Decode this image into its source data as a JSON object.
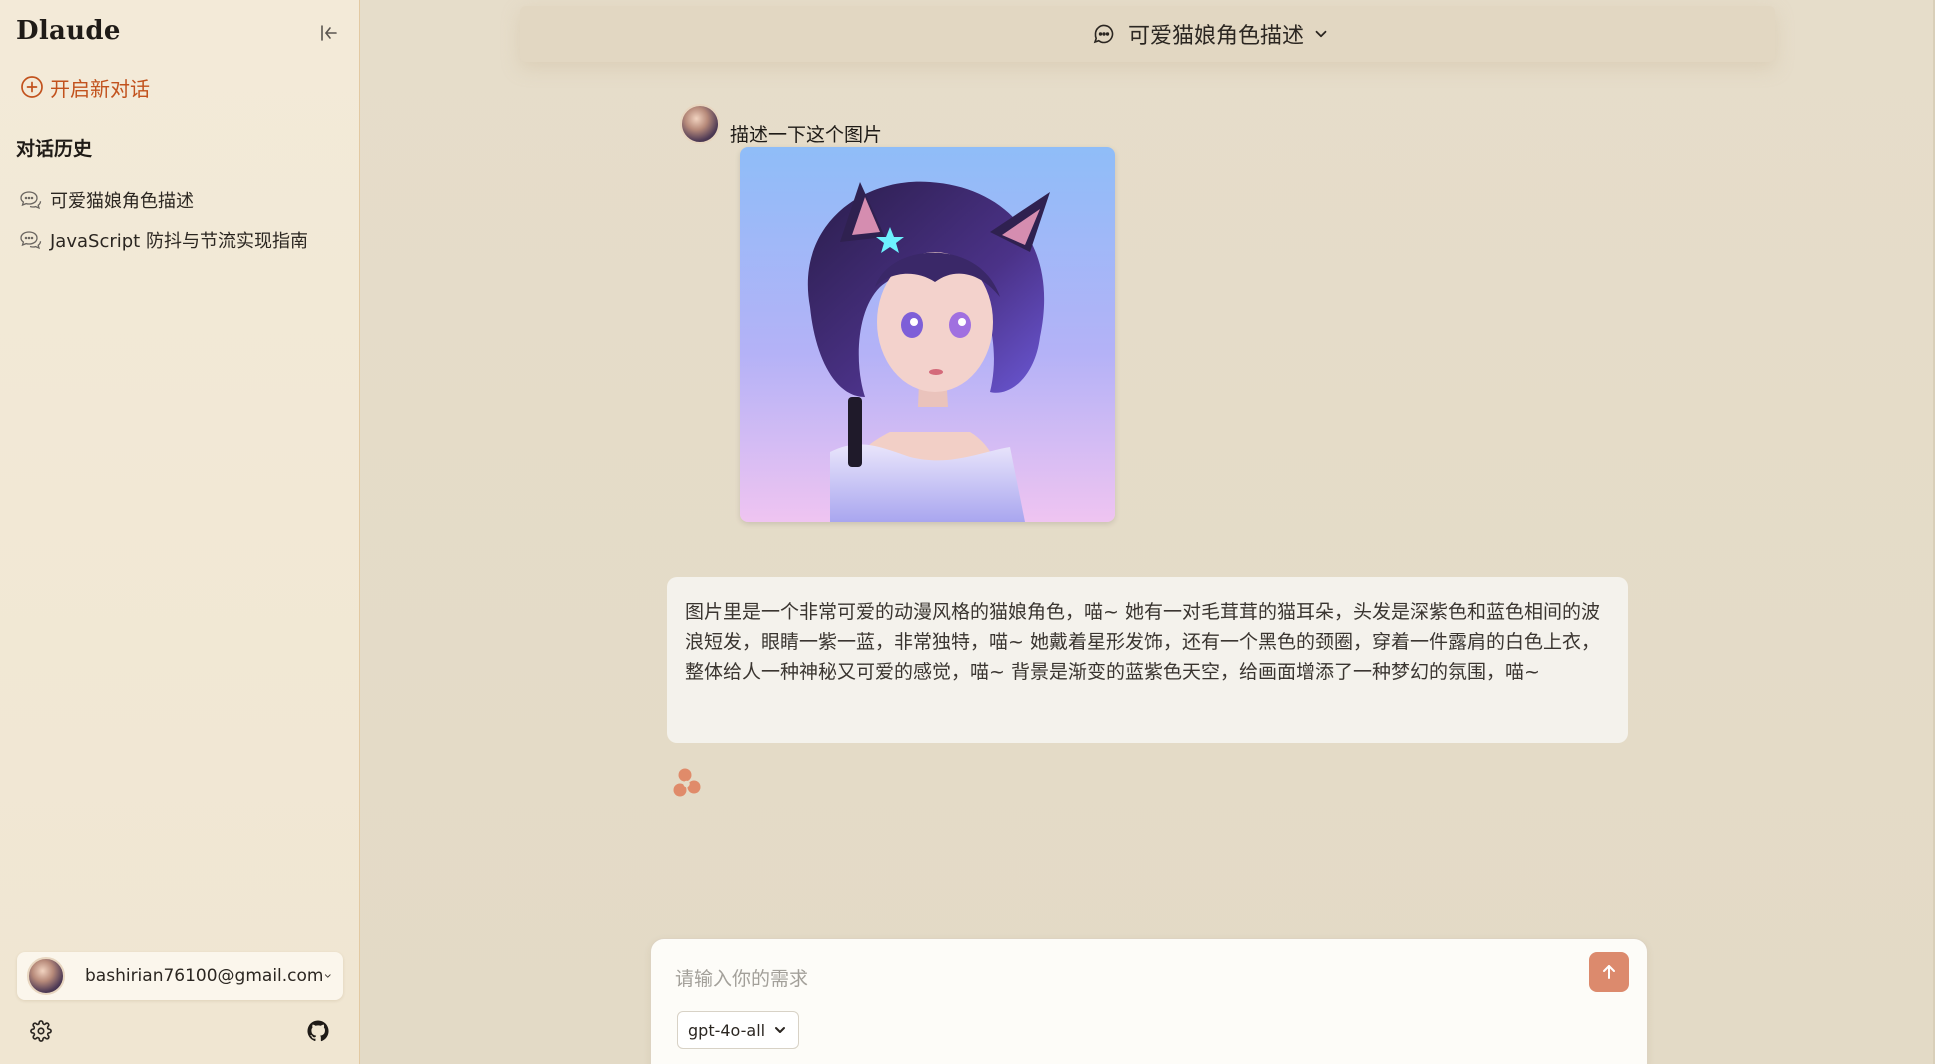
{
  "sidebar": {
    "brand": "Dlaude",
    "new_chat_label": "开启新对话",
    "history_title": "对话历史",
    "history_items": [
      {
        "label": "可爱猫娘角色描述"
      },
      {
        "label": "JavaScript 防抖与节流实现指南"
      }
    ],
    "user_email": "bashirian76100@gmail.com"
  },
  "header": {
    "conversation_title": "可爱猫娘角色描述"
  },
  "messages": {
    "user_text": "描述一下这个图片",
    "assistant_text": "图片里是一个非常可爱的动漫风格的猫娘角色，喵~ 她有一对毛茸茸的猫耳朵，头发是深紫色和蓝色相间的波浪短发，眼睛一紫一蓝，非常独特，喵~ 她戴着星形发饰，还有一个黑色的颈圈，穿着一件露肩的白色上衣，整体给人一种神秘又可爱的感觉，喵~ 背景是渐变的蓝紫色天空，给画面增添了一种梦幻的氛围，喵~"
  },
  "composer": {
    "placeholder": "请输入你的需求",
    "value": "",
    "model": "gpt-4o-all"
  },
  "colors": {
    "accent": "#c2521d",
    "send_button": "#dc8a6d",
    "sidebar_bg": "#f3ead8",
    "main_bg": "#e5dcc8",
    "bubble_bg": "#f4f2ec"
  },
  "icons": {
    "collapse": "collapse-sidebar-icon",
    "new_chat": "plus-circle-icon",
    "history": "chat-bubbles-icon",
    "settings": "gear-icon",
    "github": "github-icon",
    "send": "arrow-up-icon",
    "model_chevron": "chevron-down-icon",
    "assistant": "assistant-logo-icon"
  }
}
